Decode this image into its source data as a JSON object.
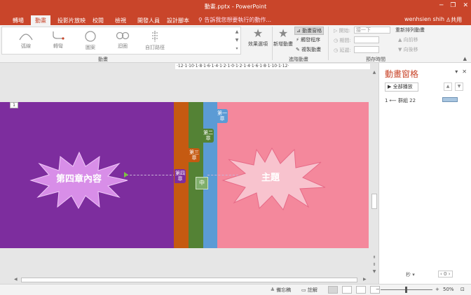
{
  "window": {
    "title": "動畫.pptx - PowerPoint",
    "controls": [
      "─",
      "❐",
      "✕"
    ]
  },
  "tabs": [
    {
      "label": "轉場",
      "active": false
    },
    {
      "label": "動畫",
      "active": true
    },
    {
      "label": "投影片放映",
      "active": false
    },
    {
      "label": "校閱",
      "active": false
    },
    {
      "label": "檢視",
      "active": false
    },
    {
      "label": "開發人員",
      "active": false
    },
    {
      "label": "設計腳本",
      "active": false
    }
  ],
  "tell_me": "告訴我您想要執行的動作...",
  "user": "wenhsien shih",
  "share": "共用",
  "ribbon": {
    "animations": [
      {
        "label": "弧線",
        "icon": "arc-icon"
      },
      {
        "label": "轉彎",
        "icon": "turn-icon"
      },
      {
        "label": "圖案",
        "icon": "shape-path-icon"
      },
      {
        "label": "迴圈",
        "icon": "loop-icon"
      },
      {
        "label": "自訂路徑",
        "icon": "custom-path-icon"
      }
    ],
    "effect_options": "效果選項",
    "add_animation": "新增動畫",
    "animation_pane": "動畫窗格",
    "trigger": "觸發程序",
    "animation_painter": "複製動畫",
    "start_label": "開始:",
    "start_value": "接一下",
    "duration_label": "期間:",
    "delay_label": "延遲:",
    "reorder_title": "重新排列動畫",
    "move_earlier": "向前移",
    "move_later": "向後移",
    "group_animation": "動畫",
    "group_advanced": "進階動畫",
    "group_timing": "預存時間"
  },
  "ruler": "·12·1·10·1·8·1·6·1·4·1·2·1·0·1·2·1·4·1·6·1·8·1·10·1·12·",
  "slide": {
    "number": "1",
    "tags": {
      "ch1": "第一章",
      "ch2": "第二章",
      "ch3": "第三章",
      "ch4": "第四章"
    },
    "middle_box": "中",
    "burst_left": "第四章內容",
    "burst_right": "主題"
  },
  "pane": {
    "title": "動畫窗格",
    "play_all": "全部播放",
    "item": "1 ⟵ 群組 22",
    "seconds": "秒 ▾",
    "zoom_value": "0"
  },
  "status": {
    "notes": "備忘稿",
    "comments": "註解",
    "zoom": "50%"
  },
  "colors": {
    "accent": "#c9452a",
    "purple_panel": "#7d2d9e",
    "orange_panel": "#c55a11",
    "green_panel": "#548235",
    "blue_panel": "#5b9bd5",
    "pink_bg": "#f4889c"
  }
}
